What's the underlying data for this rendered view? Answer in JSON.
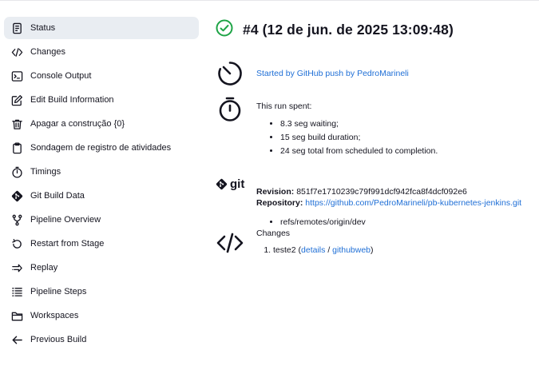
{
  "sidebar": {
    "items": [
      {
        "label": "Status",
        "icon": "document-icon",
        "active": true
      },
      {
        "label": "Changes",
        "icon": "code-icon"
      },
      {
        "label": "Console Output",
        "icon": "terminal-icon"
      },
      {
        "label": "Edit Build Information",
        "icon": "edit-icon"
      },
      {
        "label": "Apagar a construção {0}",
        "icon": "trash-icon"
      },
      {
        "label": "Sondagem de registro de atividades",
        "icon": "clipboard-icon"
      },
      {
        "label": "Timings",
        "icon": "stopwatch-icon"
      },
      {
        "label": "Git Build Data",
        "icon": "git-icon"
      },
      {
        "label": "Pipeline Overview",
        "icon": "pipeline-icon"
      },
      {
        "label": "Restart from Stage",
        "icon": "restart-icon"
      },
      {
        "label": "Replay",
        "icon": "replay-icon"
      },
      {
        "label": "Pipeline Steps",
        "icon": "steps-list-icon"
      },
      {
        "label": "Workspaces",
        "icon": "folder-icon"
      },
      {
        "label": "Previous Build",
        "icon": "arrow-left-icon"
      }
    ]
  },
  "main": {
    "title": "#4 (12 de jun. de 2025 13:09:48)",
    "status_color": "#1ea446",
    "trigger": {
      "text": "Started by GitHub push by PedroMarineli"
    },
    "timing": {
      "heading": "This run spent:",
      "items": [
        "8.3 seg waiting;",
        "15 seg build duration;",
        "24 seg total from scheduled to completion."
      ]
    },
    "git": {
      "logo_text": "git",
      "revision_label": "Revision:",
      "revision_value": "851f7e1710239c79f991dcf942fca8f4dcf092e6",
      "repository_label": "Repository:",
      "repository_url": "https://github.com/PedroMarineli/pb-kubernetes-jenkins.git",
      "refs": [
        "refs/remotes/origin/dev"
      ]
    },
    "changes": {
      "heading": "Changes",
      "items": [
        {
          "name": "teste2",
          "details_label": "details",
          "sep": "/",
          "web_label": "githubweb"
        }
      ]
    }
  }
}
